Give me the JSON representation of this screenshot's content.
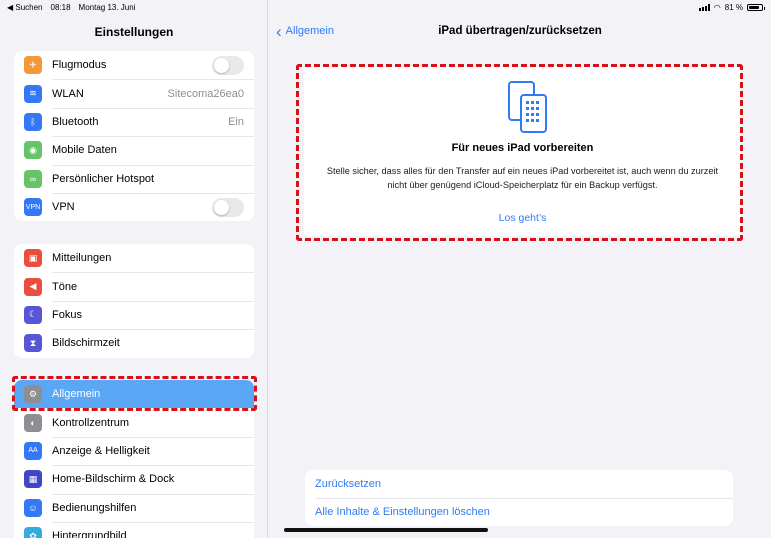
{
  "status_bar": {
    "back_app": "◀ Suchen",
    "time": "08:18",
    "date": "Montag 13. Juni",
    "battery": "81 %"
  },
  "sidebar": {
    "title": "Einstellungen",
    "group1": [
      {
        "label": "Flugmodus",
        "icon": "airplane-icon",
        "color": "#f19a37",
        "glyph": "✈",
        "accessory": "toggle"
      },
      {
        "label": "WLAN",
        "icon": "wifi-icon",
        "color": "#3478f6",
        "glyph": "≋",
        "value": "Sitecoma26ea0"
      },
      {
        "label": "Bluetooth",
        "icon": "bluetooth-icon",
        "color": "#3478f6",
        "glyph": "ᛒ",
        "value": "Ein"
      },
      {
        "label": "Mobile Daten",
        "icon": "antenna-icon",
        "color": "#65c466",
        "glyph": "◉"
      },
      {
        "label": "Persönlicher Hotspot",
        "icon": "hotspot-icon",
        "color": "#65c466",
        "glyph": "∞"
      },
      {
        "label": "VPN",
        "icon": "vpn-icon",
        "color": "#3478f6",
        "glyph": "VPN",
        "accessory": "toggle"
      }
    ],
    "group2": [
      {
        "label": "Mitteilungen",
        "icon": "notifications-icon",
        "color": "#eb4e3d",
        "glyph": "▣"
      },
      {
        "label": "Töne",
        "icon": "sounds-icon",
        "color": "#eb4e3d",
        "glyph": "◀"
      },
      {
        "label": "Fokus",
        "icon": "moon-icon",
        "color": "#5856d6",
        "glyph": "☾"
      },
      {
        "label": "Bildschirmzeit",
        "icon": "hourglass-icon",
        "color": "#5856d6",
        "glyph": "⧗"
      }
    ],
    "group3": [
      {
        "label": "Allgemein",
        "icon": "gear-icon",
        "color": "#8e8e93",
        "glyph": "⚙",
        "selected": true
      },
      {
        "label": "Kontrollzentrum",
        "icon": "switches-icon",
        "color": "#8e8e93",
        "glyph": "◐"
      },
      {
        "label": "Anzeige & Helligkeit",
        "icon": "display-icon",
        "color": "#3478f6",
        "glyph": "AA"
      },
      {
        "label": "Home-Bildschirm & Dock",
        "icon": "home-grid-icon",
        "color": "#3f47c8",
        "glyph": "▦"
      },
      {
        "label": "Bedienungshilfen",
        "icon": "accessibility-icon",
        "color": "#3478f6",
        "glyph": "☺"
      },
      {
        "label": "Hintergrundbild",
        "icon": "flower-icon",
        "color": "#36aadc",
        "glyph": "✿"
      }
    ]
  },
  "main": {
    "back_label": "Allgemein",
    "title": "iPad übertragen/zurücksetzen",
    "card": {
      "title": "Für neues iPad vorbereiten",
      "description": "Stelle sicher, dass alles für den Transfer auf ein neues iPad vorbereitet ist, auch wenn du zurzeit nicht über genügend iCloud-Speicherplatz für ein Backup verfügst.",
      "link": "Los geht’s"
    },
    "bottom_actions": [
      "Zurücksetzen",
      "Alle Inhalte & Einstellungen löschen"
    ]
  },
  "colors": {
    "accent": "#2f7bf6",
    "selected_row": "#5aa8f5",
    "highlight": "#d7111a"
  }
}
